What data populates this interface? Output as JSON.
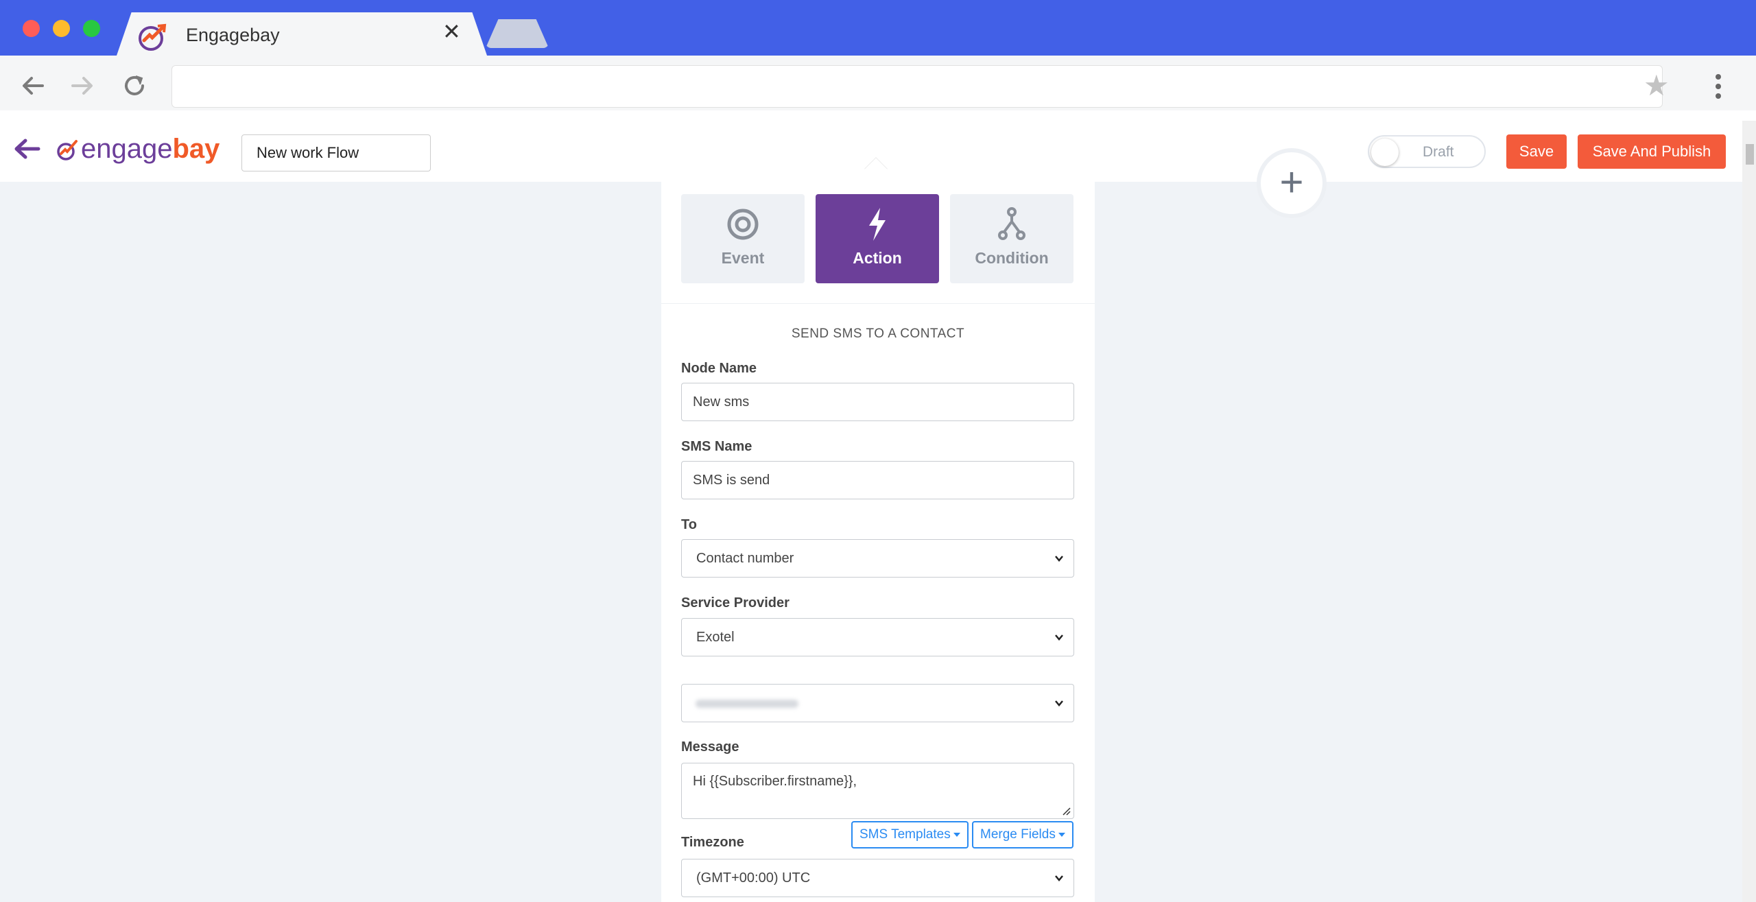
{
  "browser": {
    "tab_title": "Engagebay",
    "tab_close": "✕",
    "url": ""
  },
  "header": {
    "brand_engage": "engage",
    "brand_bay": "bay",
    "workflow_name": "New work Flow",
    "draft_label": "Draft",
    "draft_enabled": false,
    "save_label": "Save",
    "publish_label": "Save And Publish",
    "add_node_symbol": "+"
  },
  "panel": {
    "tabs": [
      {
        "label": "Event",
        "icon": "target-icon",
        "active": false
      },
      {
        "label": "Action",
        "icon": "lightning-icon",
        "active": true
      },
      {
        "label": "Condition",
        "icon": "branch-icon",
        "active": false
      }
    ],
    "section_title": "SEND SMS TO A CONTACT",
    "node_name": {
      "label": "Node Name",
      "value": "New sms"
    },
    "sms_name": {
      "label": "SMS Name",
      "value": "SMS is send"
    },
    "to": {
      "label": "To",
      "value": "Contact number"
    },
    "service_provider": {
      "label": "Service Provider",
      "value": "Exotel"
    },
    "sender": {
      "value": ""
    },
    "message": {
      "label": "Message",
      "value": "Hi {{Subscriber.firstname}},"
    },
    "sms_templates_label": "SMS Templates",
    "merge_fields_label": "Merge Fields",
    "timezone": {
      "label": "Timezone",
      "value": "(GMT+00:00) UTC"
    }
  },
  "colors": {
    "browser_bar": "#4260e7",
    "brand_purple": "#6c3e9a",
    "brand_orange": "#f05a28",
    "primary_button": "#f35b3b",
    "action_tab": "#6c3f99",
    "link_blue": "#2a8bf2"
  }
}
